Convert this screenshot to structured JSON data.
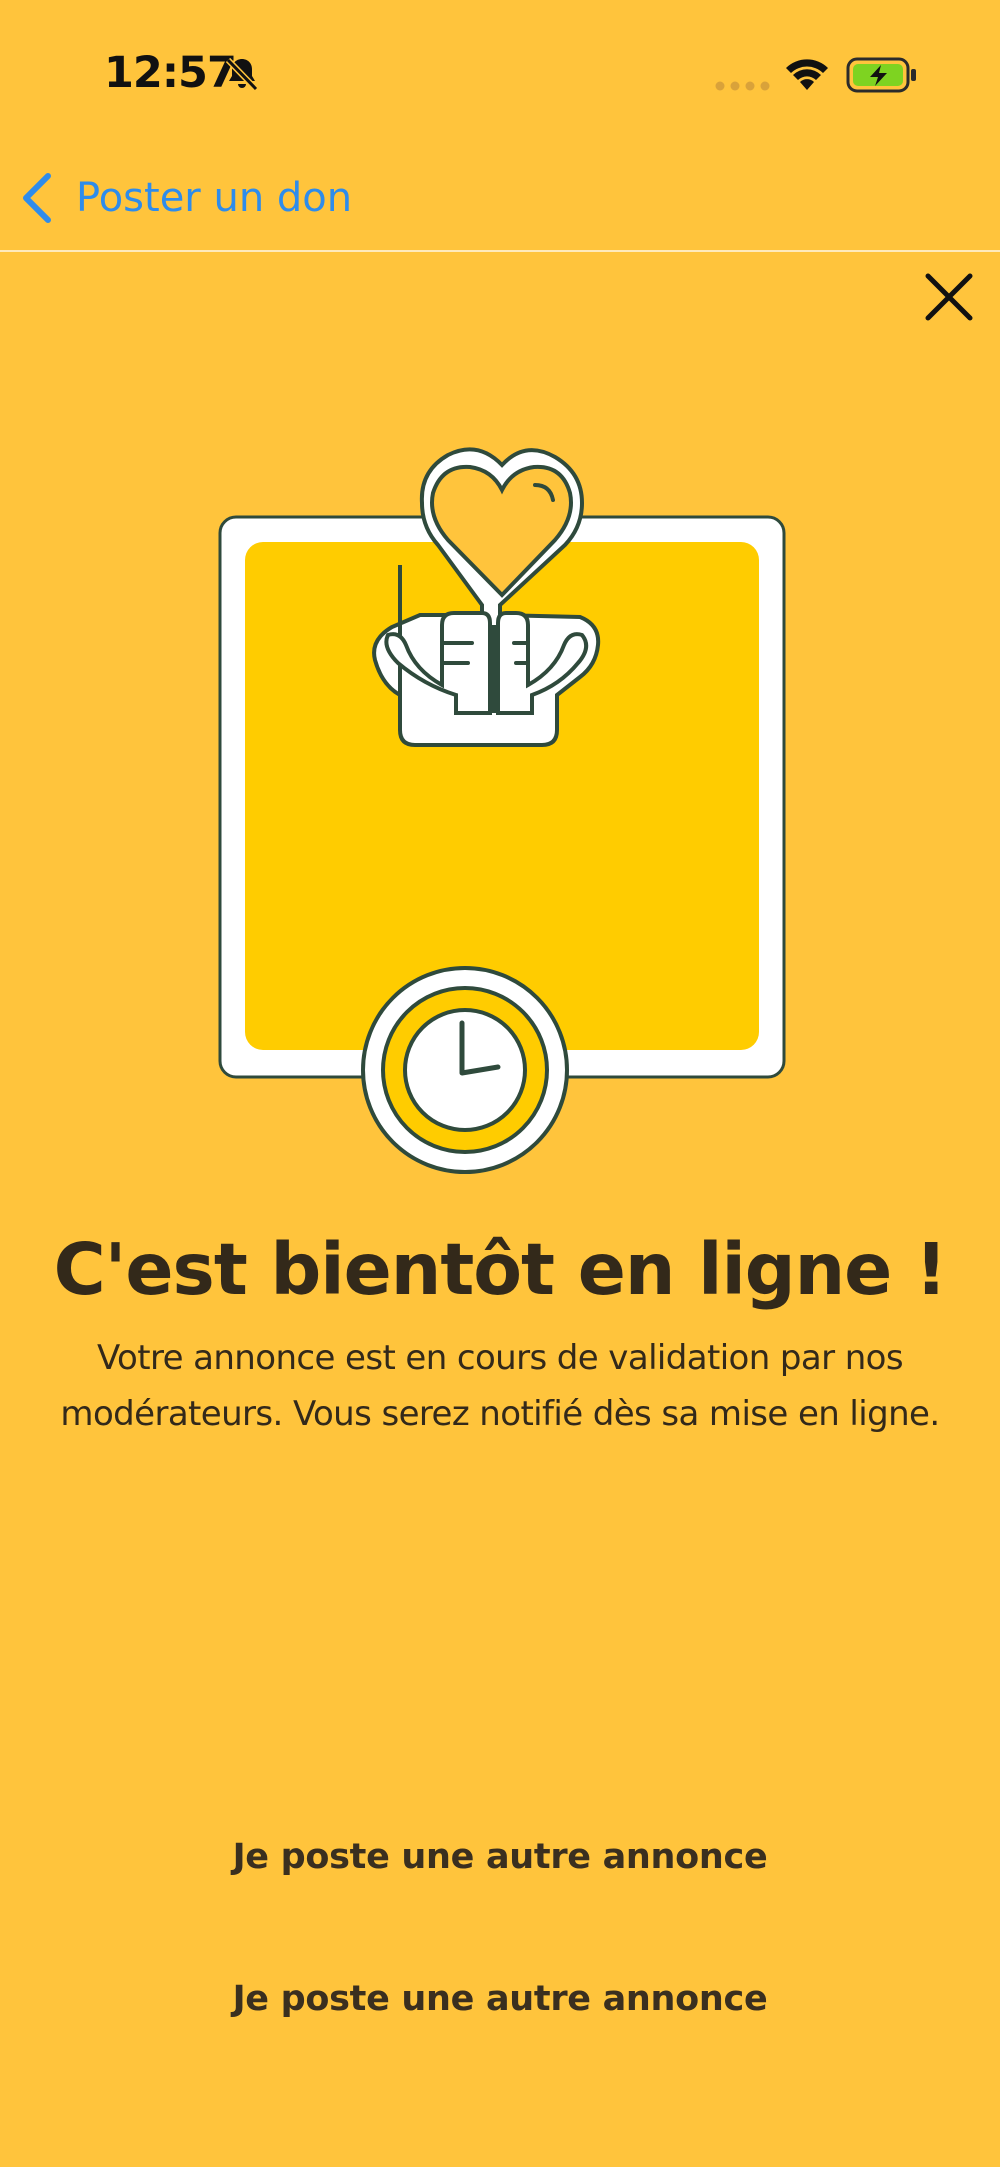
{
  "status_bar": {
    "time": "12:57",
    "icons": [
      "bell-slash-icon",
      "cellular-signal-icon",
      "wifi-icon",
      "battery-charging-icon"
    ]
  },
  "nav": {
    "back_label": "Poster un don",
    "back_icon": "chevron-left-icon",
    "close_icon": "close-icon"
  },
  "illustration": {
    "icons": [
      "heart-hands-icon",
      "clock-icon"
    ]
  },
  "content": {
    "title": "C'est bientôt en ligne !",
    "message_line1": "Votre annonce est en cours de validation par nos",
    "message_line2": "modérateurs. Vous serez notifié dès sa mise en ligne."
  },
  "actions": {
    "primary_label": "Je poste une autre annonce",
    "secondary_label": "Je poste une autre annonce"
  },
  "colors": {
    "background": "#FFC43C",
    "panel_fill": "#FFCC00",
    "outline": "#2F4A3C",
    "link": "#2E8CEB",
    "text": "#33291A",
    "battery": "#7ED321"
  }
}
